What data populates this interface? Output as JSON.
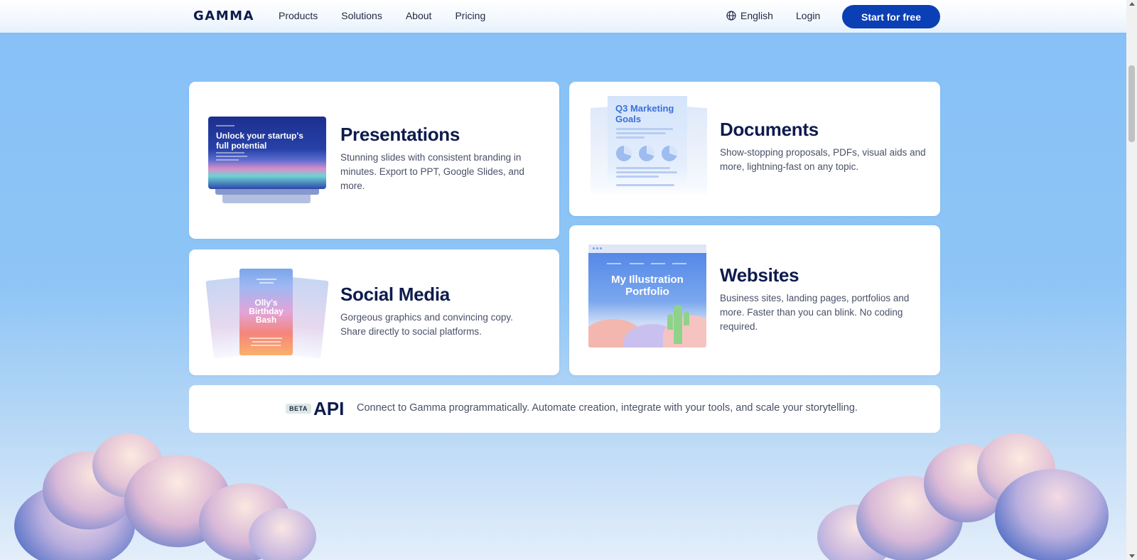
{
  "header": {
    "logo": "GAMMA",
    "nav": [
      "Products",
      "Solutions",
      "About",
      "Pricing"
    ],
    "language": "English",
    "login": "Login",
    "cta": "Start for free"
  },
  "cards": {
    "presentations": {
      "title": "Presentations",
      "description": "Stunning slides with consistent branding in minutes. Export to PPT, Google Slides, and more.",
      "thumb_text": "Unlock your startup's full potential"
    },
    "documents": {
      "title": "Documents",
      "description": "Show-stopping proposals, PDFs, visual aids and more, lightning-fast on any topic.",
      "thumb_text": "Q3 Marketing Goals"
    },
    "social": {
      "title": "Social Media",
      "description": "Gorgeous graphics and convincing copy. Share directly to social platforms.",
      "thumb_text": "Olly's Birthday Bash"
    },
    "websites": {
      "title": "Websites",
      "description": "Business sites, landing pages, portfolios and more. Faster than you can blink. No coding required.",
      "thumb_text": "My Illustration Portfolio"
    }
  },
  "api": {
    "badge": "BETA",
    "title": "API",
    "description": "Connect to Gamma programmatically. Automate creation, integrate with your tools, and scale your storytelling."
  },
  "colors": {
    "brand_dark": "#0e1b4d",
    "cta_blue": "#0b3fb5",
    "sky": "#86c0f7"
  }
}
